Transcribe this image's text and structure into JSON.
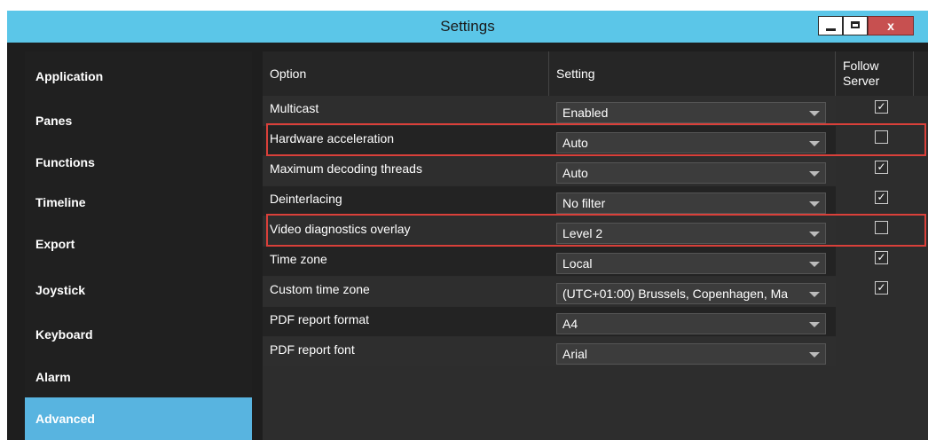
{
  "window": {
    "title": "Settings",
    "close_label": "x"
  },
  "sidebar": {
    "items": [
      {
        "label": "Application"
      },
      {
        "label": "Panes"
      },
      {
        "label": "Functions"
      },
      {
        "label": "Timeline"
      },
      {
        "label": "Export"
      },
      {
        "label": "Joystick"
      },
      {
        "label": "Keyboard"
      },
      {
        "label": "Alarm"
      },
      {
        "label": "Advanced",
        "active": true
      }
    ]
  },
  "grid": {
    "columns": {
      "option": "Option",
      "setting": "Setting",
      "follow_server": "Follow Server"
    },
    "rows": [
      {
        "option": "Multicast",
        "setting": "Enabled",
        "follow_server": true
      },
      {
        "option": "Hardware acceleration",
        "setting": "Auto",
        "follow_server": false,
        "highlighted": true
      },
      {
        "option": "Maximum decoding threads",
        "setting": "Auto",
        "follow_server": true
      },
      {
        "option": "Deinterlacing",
        "setting": "No filter",
        "follow_server": true
      },
      {
        "option": "Video diagnostics overlay",
        "setting": "Level 2",
        "follow_server": false,
        "highlighted": true
      },
      {
        "option": "Time zone",
        "setting": "Local",
        "follow_server": true
      },
      {
        "option": "Custom time zone",
        "setting": "(UTC+01:00) Brussels, Copenhagen, Ma",
        "follow_server": true
      },
      {
        "option": "PDF report format",
        "setting": "A4",
        "follow_server": null
      },
      {
        "option": "PDF report font",
        "setting": "Arial",
        "follow_server": null
      }
    ]
  },
  "colors": {
    "accent": "#58b4e0",
    "titlebar": "#5bc6e8",
    "highlight": "#d9403a"
  }
}
